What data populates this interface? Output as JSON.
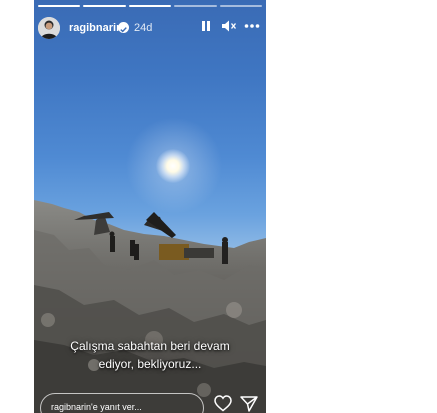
{
  "story": {
    "username": "ragibnarin",
    "age": "24d",
    "segments": [
      true,
      true,
      true,
      false,
      false
    ],
    "caption_line1": "Çalışma sabahtan beri devam",
    "caption_line2": "ediyor, bekliyoruz...",
    "reply_placeholder": "ragibnarin'e yanıt ver...",
    "icons": {
      "avatar": "profile-avatar",
      "verified": "verified-badge-icon",
      "pause": "pause-icon",
      "mute": "mute-icon",
      "more": "more-icon",
      "like": "heart-icon",
      "share": "send-icon"
    }
  }
}
